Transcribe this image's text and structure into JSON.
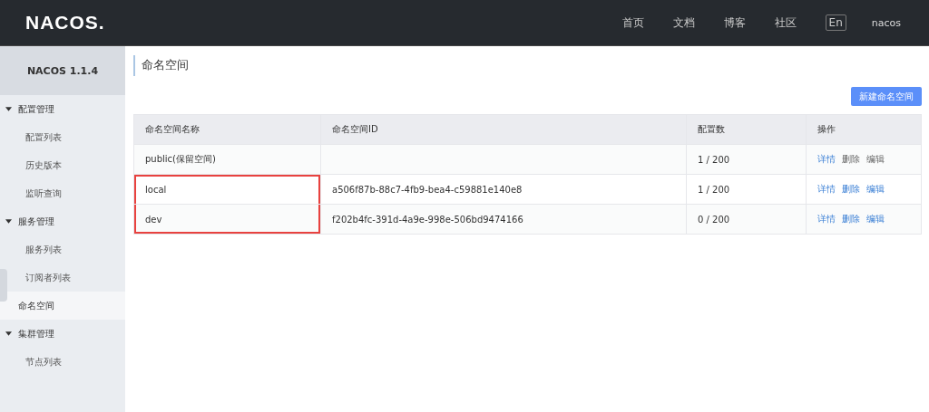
{
  "header": {
    "logo": "NACOS.",
    "nav": [
      {
        "label": "首页"
      },
      {
        "label": "文档"
      },
      {
        "label": "博客"
      },
      {
        "label": "社区"
      }
    ],
    "language": "En",
    "user": "nacos"
  },
  "sidebar": {
    "title": "NACOS 1.1.4",
    "groups": [
      {
        "label": "配置管理",
        "expanded": true,
        "children": [
          {
            "label": "配置列表",
            "selected": false
          },
          {
            "label": "历史版本",
            "selected": false
          },
          {
            "label": "监听查询",
            "selected": false
          }
        ]
      },
      {
        "label": "服务管理",
        "expanded": true,
        "children": [
          {
            "label": "服务列表",
            "selected": false
          },
          {
            "label": "订阅者列表",
            "selected": false
          }
        ]
      },
      {
        "label": "命名空间",
        "kind": "link",
        "selected": true
      },
      {
        "label": "集群管理",
        "expanded": true,
        "children": [
          {
            "label": "节点列表",
            "selected": false
          }
        ]
      }
    ]
  },
  "page": {
    "title": "命名空间",
    "new_button": "新建命名空间"
  },
  "table": {
    "columns": [
      "命名空间名称",
      "命名空间ID",
      "配置数",
      "操作"
    ],
    "rows": [
      {
        "name": "public(保留空间)",
        "id": "",
        "count": "1 / 200",
        "highlighted": false,
        "actions": [
          {
            "label": "详情",
            "disabled": false
          },
          {
            "label": "删除",
            "disabled": true
          },
          {
            "label": "编辑",
            "disabled": true
          }
        ]
      },
      {
        "name": "local",
        "id": "a506f87b-88c7-4fb9-bea4-c59881e140e8",
        "count": "1 / 200",
        "highlighted": true,
        "actions": [
          {
            "label": "详情",
            "disabled": false
          },
          {
            "label": "删除",
            "disabled": false
          },
          {
            "label": "编辑",
            "disabled": false
          }
        ]
      },
      {
        "name": "dev",
        "id": "f202b4fc-391d-4a9e-998e-506bd9474166",
        "count": "0 / 200",
        "highlighted": true,
        "actions": [
          {
            "label": "详情",
            "disabled": false
          },
          {
            "label": "删除",
            "disabled": false
          },
          {
            "label": "编辑",
            "disabled": false
          }
        ]
      }
    ]
  }
}
